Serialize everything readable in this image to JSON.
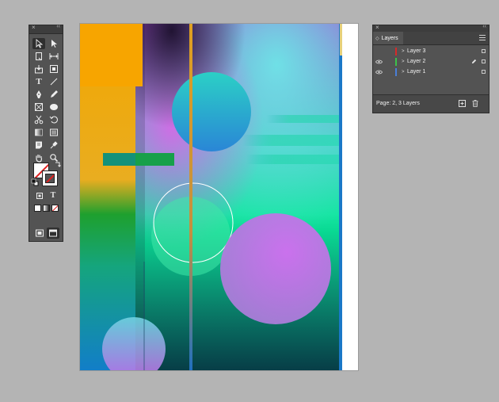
{
  "tools_panel": {
    "close_glyph": "×",
    "collapse_glyph": "‹‹",
    "tools": [
      {
        "name": "selection-tool-icon",
        "active": true
      },
      {
        "name": "direct-selection-tool-icon"
      },
      {
        "name": "page-tool-icon"
      },
      {
        "name": "gap-tool-icon"
      },
      {
        "name": "content-collector-icon"
      },
      {
        "name": "content-placer-icon"
      },
      {
        "name": "type-tool-icon"
      },
      {
        "name": "line-tool-icon"
      },
      {
        "name": "pen-tool-icon"
      },
      {
        "name": "pencil-tool-icon"
      },
      {
        "name": "rectangle-frame-tool-icon"
      },
      {
        "name": "ellipse-tool-icon"
      },
      {
        "name": "scissors-tool-icon"
      },
      {
        "name": "free-transform-tool-icon"
      },
      {
        "name": "gradient-swatch-tool-icon"
      },
      {
        "name": "gradient-feather-tool-icon"
      },
      {
        "name": "note-tool-icon"
      },
      {
        "name": "eyedropper-tool-icon"
      },
      {
        "name": "hand-tool-icon"
      },
      {
        "name": "zoom-tool-icon"
      }
    ],
    "type_glyph": "T"
  },
  "layers_panel": {
    "close_glyph": "×",
    "collapse_glyph": "‹‹",
    "tab_arrow": "◇",
    "title": "Layers",
    "layers": [
      {
        "name": "Layer 3",
        "color": "#d62a2a",
        "visible": false,
        "pen": false
      },
      {
        "name": "Layer 2",
        "color": "#3cc24a",
        "visible": true,
        "pen": true
      },
      {
        "name": "Layer 1",
        "color": "#4a7fd8",
        "visible": true,
        "pen": false
      }
    ],
    "expand_glyph": ">",
    "status": "Page: 2, 3 Layers"
  }
}
